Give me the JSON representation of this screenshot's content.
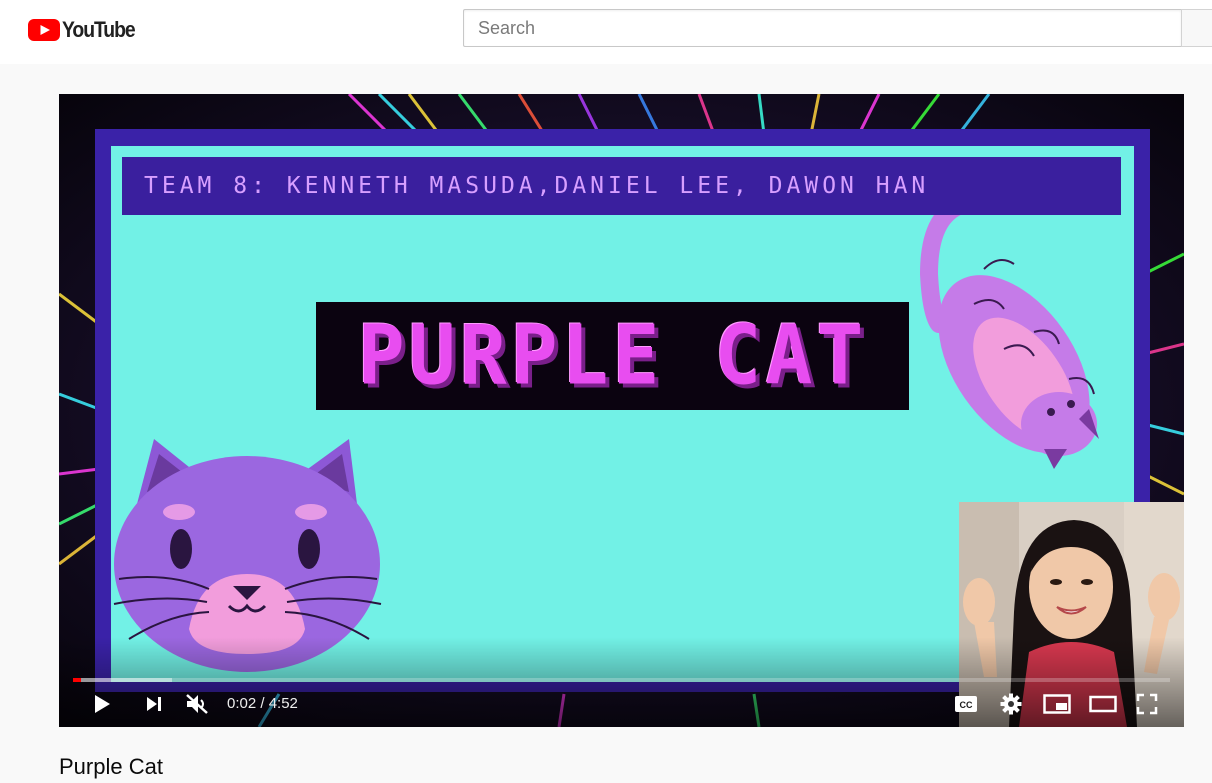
{
  "masthead": {
    "logo_text": "YouTube",
    "logo_icon": "youtube-play-icon",
    "brand_color": "#ff0000",
    "search": {
      "placeholder": "Search",
      "value": ""
    }
  },
  "player": {
    "content": {
      "team_banner": "TEAM 8: KENNETH MASUDA,DANIEL LEE, DAWON HAN",
      "title_card": "PURPLE CAT"
    },
    "progress": {
      "played_fraction": 0.007,
      "buffered_fraction": 0.09,
      "played_color": "#ff0000"
    },
    "time": {
      "current": "0:02",
      "duration": "4:52",
      "display": "0:02 / 4:52"
    },
    "controls": {
      "play": "play-icon",
      "next": "next-icon",
      "volume": "muted-volume-icon",
      "captions": "closed-captions-icon",
      "settings": "gear-icon",
      "miniplayer": "miniplayer-icon",
      "theater": "theater-mode-icon",
      "fullscreen": "fullscreen-icon"
    }
  },
  "video": {
    "title": "Purple Cat"
  }
}
